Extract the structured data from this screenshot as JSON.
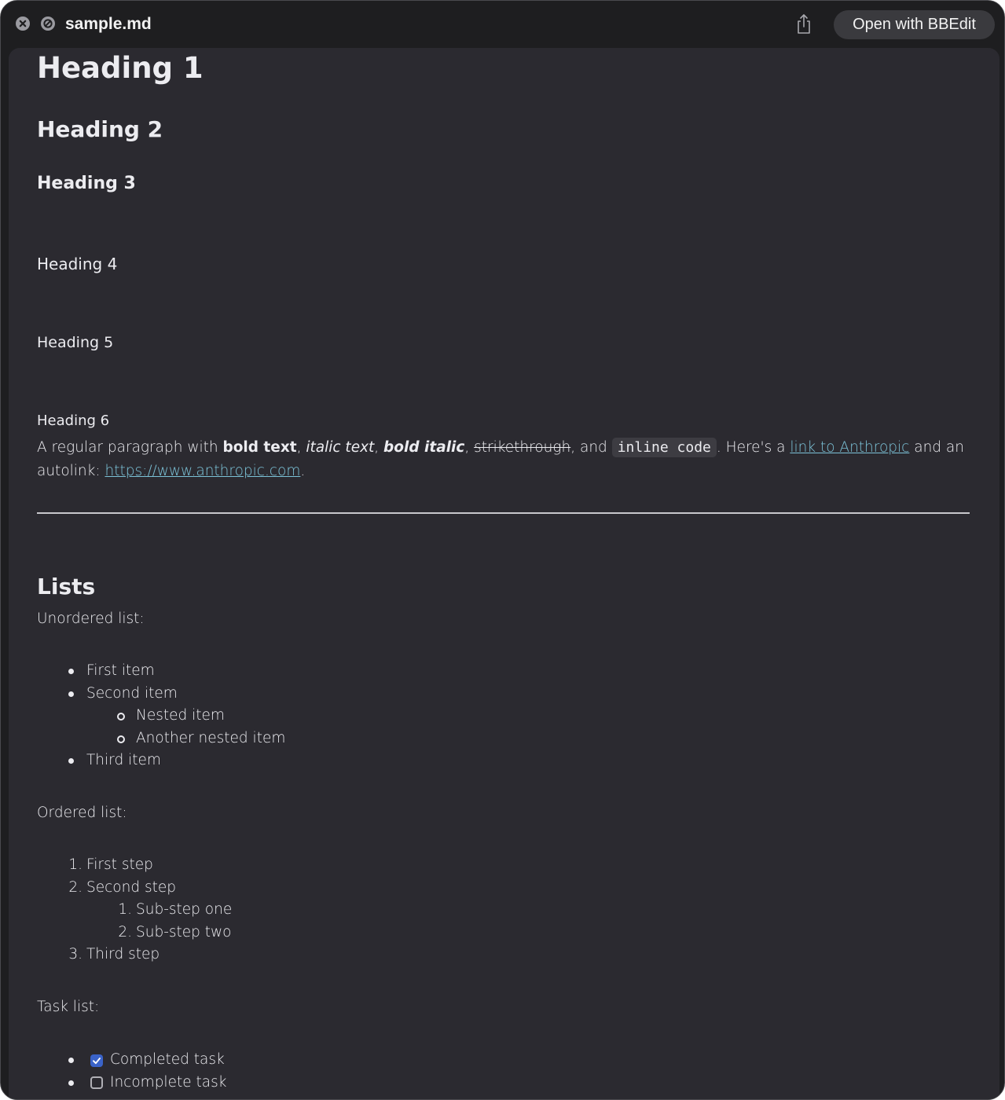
{
  "window": {
    "title": "sample.md",
    "open_button_label": "Open with BBEdit"
  },
  "icons": {
    "close": "close-icon",
    "noentry": "no-entry-icon",
    "share": "share-icon"
  },
  "colors": {
    "link": "#7cc3d8",
    "checkbox_checked": "#3a63c9",
    "content_bg": "#2b2a30"
  },
  "doc": {
    "h1": "Heading 1",
    "h2": "Heading 2",
    "h3": "Heading 3",
    "h4": "Heading 4",
    "h5": "Heading 5",
    "h6": "Heading 6",
    "paragraph": {
      "t1": "A regular paragraph with ",
      "bold": "bold text",
      "t2": ", ",
      "italic": "italic text",
      "t3": ", ",
      "bold_italic": "bold italic",
      "t4": ", ",
      "strike": "strikethrough",
      "t5": ", and ",
      "code": "inline code",
      "t6": ". Here's a ",
      "link": "link to Anthropic",
      "t7": " and an autolink: ",
      "autolink": "https://www.anthropic.com",
      "t8": "."
    },
    "lists_heading": "Lists",
    "unordered_label": "Unordered list:",
    "unordered": {
      "item1": "First item",
      "item2": "Second item",
      "nested1": "Nested item",
      "nested2": "Another nested item",
      "item3": "Third item"
    },
    "ordered_label": "Ordered list:",
    "ordered": {
      "n1": "1.",
      "step1": "First step",
      "n2": "2.",
      "step2": "Second step",
      "sn1": "1.",
      "sub1": "Sub-step one",
      "sn2": "2.",
      "sub2": "Sub-step two",
      "n3": "3.",
      "step3": "Third step"
    },
    "task_label": "Task list:",
    "tasks": {
      "done": "Completed task",
      "done_checked": true,
      "todo": "Incomplete task",
      "todo_checked": false
    }
  }
}
